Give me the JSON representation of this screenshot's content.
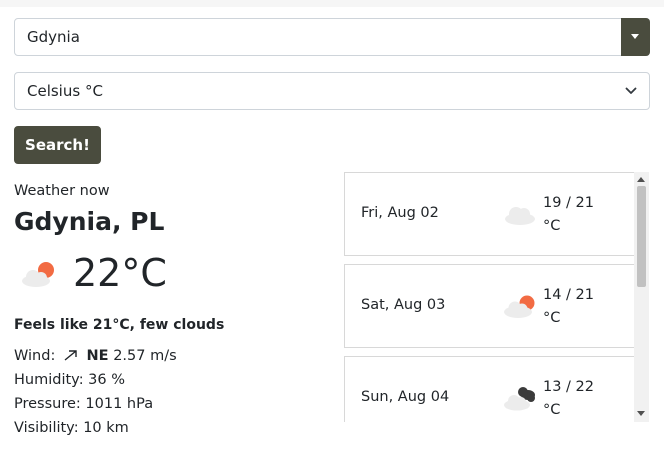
{
  "city_select": {
    "value": "Gdynia"
  },
  "unit_select": {
    "value": "Celsius °C"
  },
  "search_button": {
    "label": "Search!"
  },
  "current": {
    "heading": "Weather now",
    "location": "Gdynia, PL",
    "temperature": "22°C",
    "icon": "few-clouds-day-icon",
    "feels_like": "Feels like 21°C, few clouds",
    "wind_label": "Wind:",
    "wind_direction": "NE",
    "wind_speed": "2.57 m/s",
    "humidity": "Humidity: 36 %",
    "pressure": "Pressure: 1011 hPa",
    "visibility": "Visibility: 10 km"
  },
  "forecast": [
    {
      "date": "Fri, Aug 02",
      "range": "19 / 21",
      "unit": "°C",
      "icon": "cloud-icon"
    },
    {
      "date": "Sat, Aug 03",
      "range": "14 / 21",
      "unit": "°C",
      "icon": "few-clouds-day-icon"
    },
    {
      "date": "Sun, Aug 04",
      "range": "13 / 22",
      "unit": "°C",
      "icon": "broken-clouds-icon"
    }
  ],
  "colors": {
    "button_bg": "#4a4c3e",
    "sun": "#f26b43",
    "cloud_light": "#ececec",
    "cloud_dark": "#3b3b3b"
  }
}
